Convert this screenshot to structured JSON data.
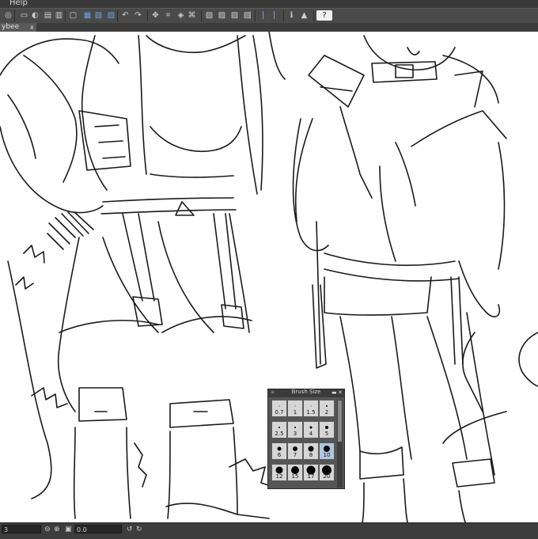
{
  "menu": {
    "help_label": "Help"
  },
  "toolbar": {
    "icons": [
      "logo-icon",
      "new-file-icon",
      "open-icon",
      "save-icon",
      "save-as-icon",
      "screen-icon",
      "clipboard-icon",
      "copy-icon",
      "paste-icon",
      "undo-icon",
      "redo-icon",
      "transform-icon",
      "crop-icon",
      "fill-icon",
      "select-icon",
      "hatch-icon",
      "hatch-icon",
      "hatch-icon",
      "hatch-icon",
      "ruler-icon",
      "ruler-icon",
      "ruler-icon",
      "info-icon",
      "graduate-icon",
      "help-icon"
    ]
  },
  "tab": {
    "label": "ybee",
    "close": "x"
  },
  "statusbar": {
    "zoom": "3",
    "angle": "0.0"
  },
  "brush_panel": {
    "title": "Brush Size",
    "minimize": "▬",
    "close": "✕",
    "sizes": [
      "0.7",
      "1",
      "1.5",
      "2",
      "2.5",
      "3",
      "4",
      "5",
      "6",
      "7",
      "8",
      "10",
      "12",
      "15",
      "17",
      "20"
    ],
    "selected": "10"
  }
}
